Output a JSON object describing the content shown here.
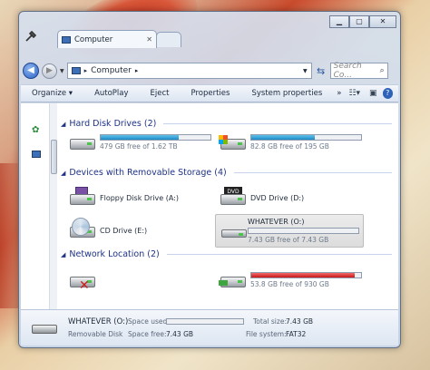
{
  "window": {
    "tab_title": "Computer",
    "caption_buttons": [
      "minimize",
      "maximize",
      "close"
    ]
  },
  "navigation": {
    "address_path": "Computer",
    "search_placeholder": "Search Co..."
  },
  "toolbar": {
    "organize": "Organize ▾",
    "autoplay": "AutoPlay",
    "eject": "Eject",
    "properties": "Properties",
    "system_properties": "System properties",
    "more": "»"
  },
  "groups": {
    "hard_disk": "Hard Disk Drives (2)",
    "removable": "Devices with Removable Storage (4)",
    "network": "Network Location (2)"
  },
  "drives": {
    "hdd1": {
      "free_text": "479 GB free of 1.62 TB",
      "used_fraction": 0.71
    },
    "hdd2": {
      "free_text": "82.8 GB free of 195 GB",
      "used_fraction": 0.58
    },
    "floppy": {
      "label": "Floppy Disk Drive (A:)"
    },
    "dvd": {
      "label": "DVD Drive (D:)"
    },
    "cd": {
      "label": "CD Drive (E:)"
    },
    "usb": {
      "label": "WHATEVER (O:)",
      "free_text": "7.43 GB free of 7.43 GB",
      "used_fraction": 0.0
    },
    "net2": {
      "free_text": "53.8 GB free of 930 GB",
      "used_fraction": 0.94
    }
  },
  "details": {
    "name": "WHATEVER (O:)",
    "type": "Removable Disk",
    "space_used_label": "Space used:",
    "space_free_label": "Space free:",
    "space_free_value": "7.43 GB",
    "total_size_label": "Total size:",
    "total_size_value": "7.43 GB",
    "file_system_label": "File system:",
    "file_system_value": "FAT32"
  },
  "colors": {
    "bar_normal": "#1d8ac6",
    "bar_full": "#c81818",
    "group_header": "#1e3287"
  },
  "icons": [
    "back-icon",
    "forward-icon",
    "computer-icon",
    "refresh-icon",
    "search-icon",
    "view-icon",
    "preview-pane-icon",
    "help-icon",
    "hard-disk-icon",
    "floppy-icon",
    "dvd-icon",
    "cd-icon",
    "usb-drive-icon",
    "network-drive-icon"
  ]
}
